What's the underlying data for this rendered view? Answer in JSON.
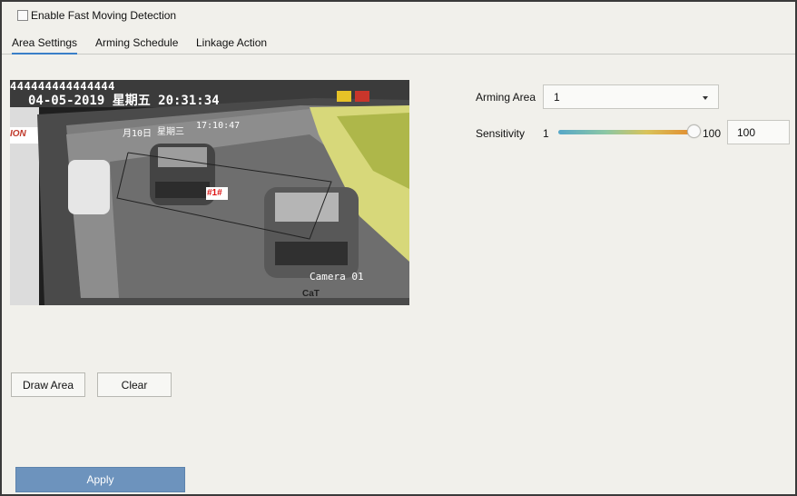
{
  "enable_detection": {
    "label": "Enable Fast Moving Detection",
    "checked": false
  },
  "tabs": [
    {
      "label": "Area Settings",
      "active": true
    },
    {
      "label": "Arming Schedule",
      "active": false
    },
    {
      "label": "Linkage Action",
      "active": false
    }
  ],
  "camera_preview": {
    "top_code": "444444444444444",
    "datetime": "04-05-2019 星期五 20:31:34",
    "inner_date": "月10日",
    "inner_weekday": "星期三",
    "inner_time": "17:10:47",
    "region_label": "#1#",
    "camera_name": "Camera 01",
    "left_sign": "ION",
    "plate_text": "CaT"
  },
  "arming_area": {
    "label": "Arming Area",
    "value": "1"
  },
  "sensitivity": {
    "label": "Sensitivity",
    "min": "1",
    "max": "100",
    "value": "100"
  },
  "buttons": {
    "draw_area": "Draw Area",
    "clear": "Clear",
    "apply": "Apply"
  },
  "colors": {
    "accent": "#3a7fc8",
    "apply_bg": "#6d93bd",
    "background": "#f1f0eb"
  }
}
